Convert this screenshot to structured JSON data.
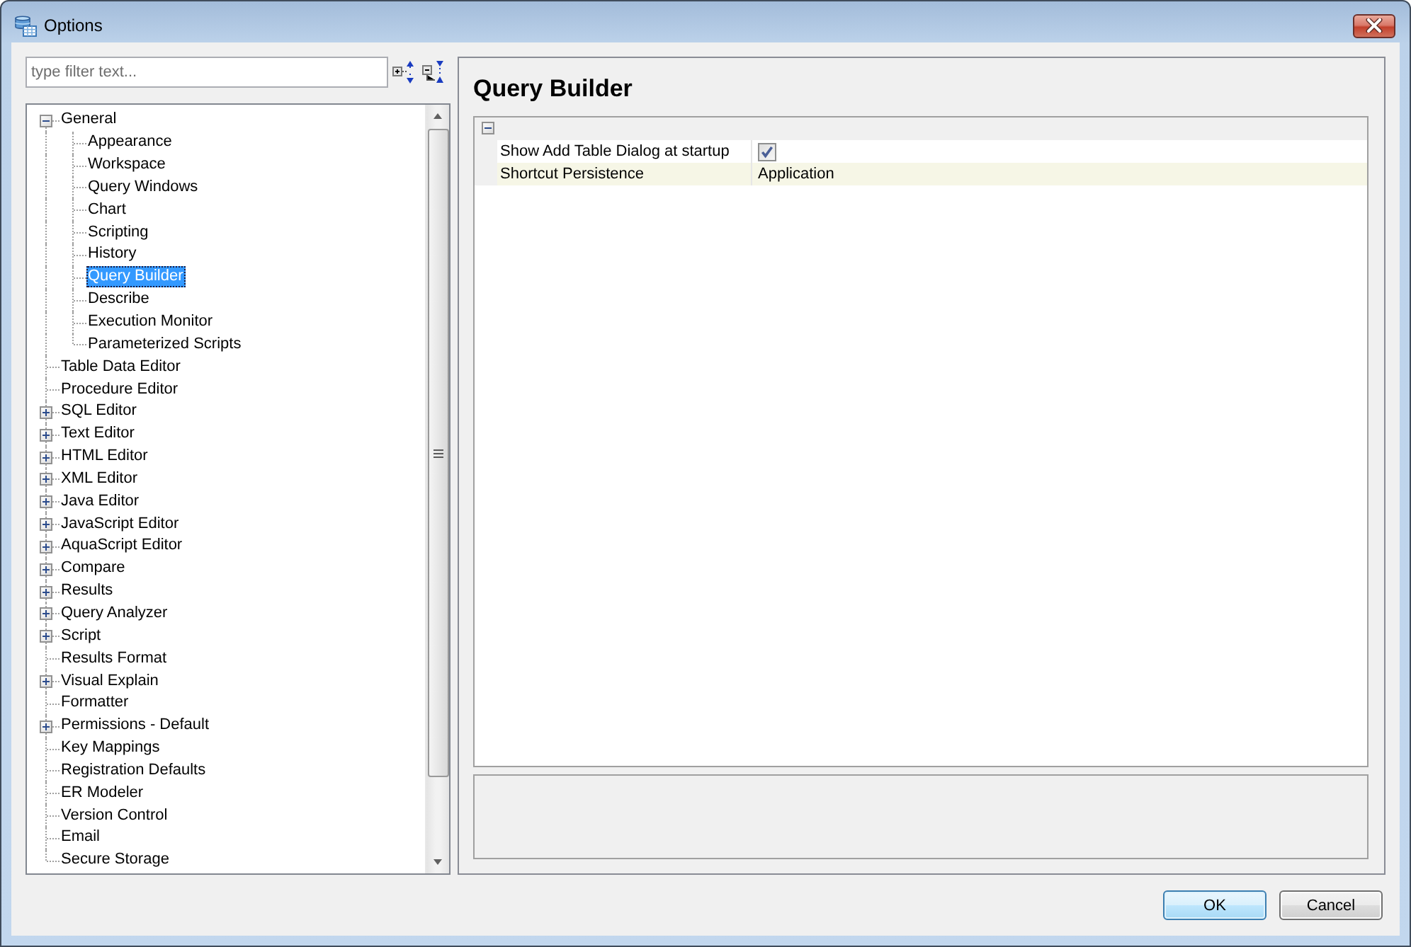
{
  "window": {
    "title": "Options"
  },
  "filter": {
    "placeholder": "type filter text..."
  },
  "tree": {
    "items": [
      {
        "label": "General",
        "expanded": true,
        "selected": false,
        "children": [
          {
            "label": "Appearance",
            "selected": false
          },
          {
            "label": "Workspace",
            "selected": false
          },
          {
            "label": "Query Windows",
            "selected": false
          },
          {
            "label": "Chart",
            "selected": false
          },
          {
            "label": "Scripting",
            "selected": false
          },
          {
            "label": "History",
            "selected": false
          },
          {
            "label": "Query Builder",
            "selected": true
          },
          {
            "label": "Describe",
            "selected": false
          },
          {
            "label": "Execution Monitor",
            "selected": false
          },
          {
            "label": "Parameterized Scripts",
            "selected": false
          }
        ]
      },
      {
        "label": "Table Data Editor",
        "selected": false
      },
      {
        "label": "Procedure Editor",
        "selected": false
      },
      {
        "label": "SQL Editor",
        "expanded": false,
        "selected": false
      },
      {
        "label": "Text Editor",
        "expanded": false,
        "selected": false
      },
      {
        "label": "HTML Editor",
        "expanded": false,
        "selected": false
      },
      {
        "label": "XML Editor",
        "expanded": false,
        "selected": false
      },
      {
        "label": "Java Editor",
        "expanded": false,
        "selected": false
      },
      {
        "label": "JavaScript Editor",
        "expanded": false,
        "selected": false
      },
      {
        "label": "AquaScript Editor",
        "expanded": false,
        "selected": false
      },
      {
        "label": "Compare",
        "expanded": false,
        "selected": false
      },
      {
        "label": "Results",
        "expanded": false,
        "selected": false
      },
      {
        "label": "Query Analyzer",
        "expanded": false,
        "selected": false
      },
      {
        "label": "Script",
        "expanded": false,
        "selected": false
      },
      {
        "label": "Results Format",
        "selected": false
      },
      {
        "label": "Visual Explain",
        "expanded": false,
        "selected": false
      },
      {
        "label": "Formatter",
        "selected": false
      },
      {
        "label": "Permissions - Default",
        "expanded": false,
        "selected": false
      },
      {
        "label": "Key Mappings",
        "selected": false
      },
      {
        "label": "Registration Defaults",
        "selected": false
      },
      {
        "label": "ER Modeler",
        "selected": false
      },
      {
        "label": "Version Control",
        "selected": false
      },
      {
        "label": "Email",
        "selected": false
      },
      {
        "label": "Secure Storage",
        "selected": false
      }
    ]
  },
  "page": {
    "title": "Query Builder",
    "category": {
      "expanded": true
    },
    "properties": [
      {
        "name": "Show Add Table Dialog at startup",
        "kind": "checkbox",
        "checked": true,
        "selected": false
      },
      {
        "name": "Shortcut Persistence",
        "kind": "text",
        "value": "Application",
        "selected": true
      }
    ]
  },
  "buttons": [
    {
      "label": "OK",
      "default": true
    },
    {
      "label": "Cancel",
      "default": false
    }
  ]
}
